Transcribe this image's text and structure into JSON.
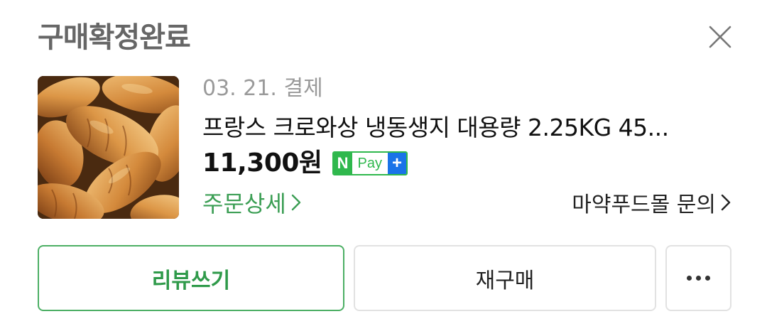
{
  "header": {
    "status_title": "구매확정완료",
    "close_icon": "close-icon"
  },
  "order": {
    "date_label": "03. 21. 결제",
    "product_name": "프랑스 크로와상 냉동생지 대용량 2.25KG 45...",
    "price": "11,300원",
    "product_image": "croissant-photo"
  },
  "npay_badge": {
    "n_label": "N",
    "pay_label": "Pay",
    "plus_label": "+"
  },
  "links": {
    "order_detail": "주문상세",
    "seller_inquiry": "마약푸드몰 문의"
  },
  "actions": {
    "review_label": "리뷰쓰기",
    "rebuy_label": "재구매",
    "more_icon": "more-horizontal-icon"
  },
  "colors": {
    "accent_green": "#2fb84d",
    "link_green": "#3b9e54",
    "npay_plus_blue": "#1a73e8",
    "status_gray": "#666666"
  }
}
